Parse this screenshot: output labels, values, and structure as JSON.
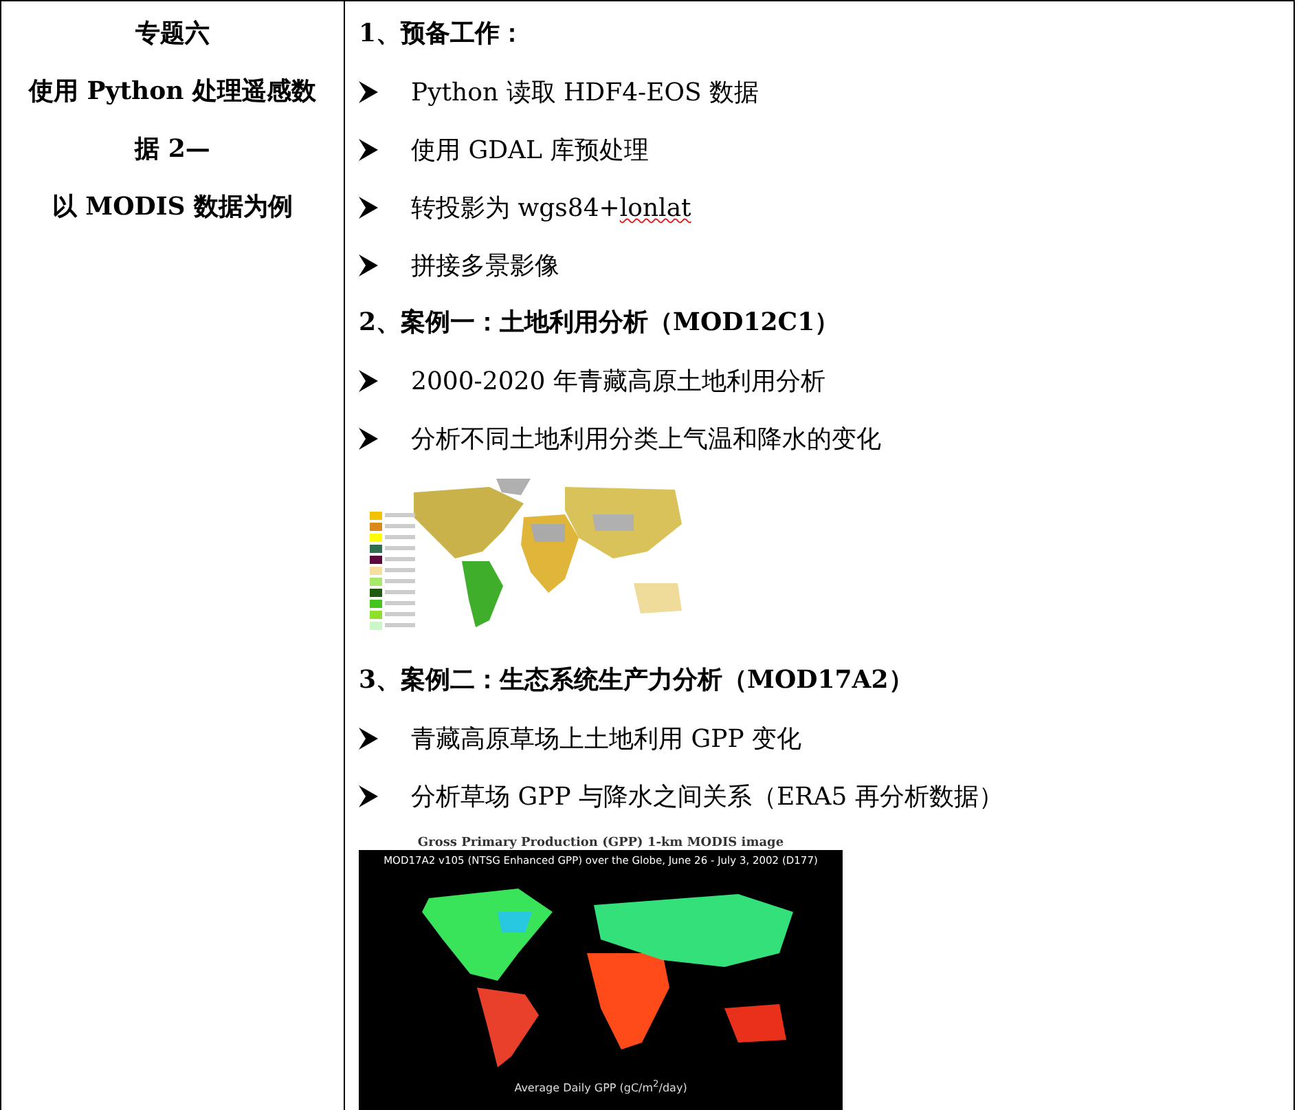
{
  "topic": {
    "lines": [
      "专题六",
      "使用 Python 处理遥感数",
      "据 2—",
      "以 MODIS 数据为例"
    ]
  },
  "sections": [
    {
      "heading": "1、预备工作：",
      "items": [
        {
          "kind": "bullet",
          "segments": [
            {
              "text": "Python 读取 HDF4-EOS 数据",
              "misspelled": false
            }
          ]
        },
        {
          "kind": "bullet",
          "segments": [
            {
              "text": "使用 GDAL 库预处理",
              "misspelled": false
            }
          ]
        },
        {
          "kind": "bullet",
          "segments": [
            {
              "text": "转投影为 wgs84+",
              "misspelled": false
            },
            {
              "text": "lonlat",
              "misspelled": true
            }
          ]
        },
        {
          "kind": "bullet",
          "segments": [
            {
              "text": "拼接多景影像",
              "misspelled": false
            }
          ]
        }
      ]
    },
    {
      "heading": "2、案例一：土地利用分析（MOD12C1）",
      "items": [
        {
          "kind": "bullet",
          "segments": [
            {
              "text": "2000-2020 年青藏高原土地利用分析",
              "misspelled": false
            }
          ]
        },
        {
          "kind": "bullet",
          "segments": [
            {
              "text": "分析不同土地利用分类上气温和降水的变化",
              "misspelled": false
            }
          ]
        },
        {
          "kind": "landcover_map"
        }
      ]
    },
    {
      "heading": "3、案例二：生态系统生产力分析（MOD17A2）",
      "items": [
        {
          "kind": "bullet",
          "segments": [
            {
              "text": "青藏高原草场上土地利用 GPP 变化",
              "misspelled": false
            }
          ]
        },
        {
          "kind": "bullet",
          "segments": [
            {
              "text": "分析草场 GPP 与降水之间关系（ERA5 再分析数据）",
              "misspelled": false
            }
          ]
        },
        {
          "kind": "gpp_map",
          "caption": "Gross Primary Production (GPP) 1-km MODIS image",
          "title": "MOD17A2 v105 (NTSG Enhanced GPP) over the Globe, June 26 - July 3, 2002 (D177)",
          "legend": "Average Daily GPP (gC/m$^{2}$/day)"
        }
      ]
    }
  ]
}
